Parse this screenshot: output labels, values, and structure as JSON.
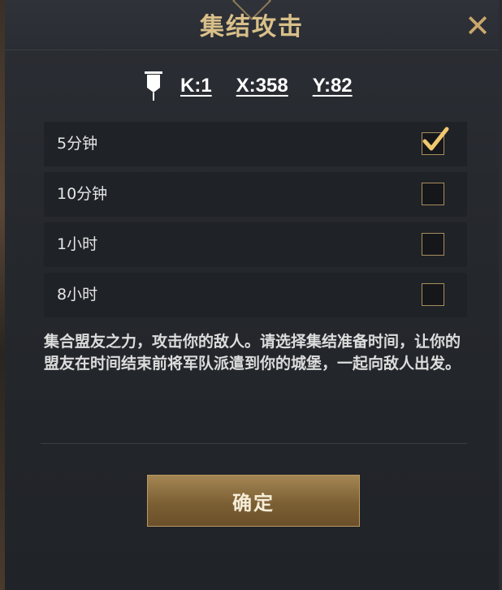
{
  "dialog": {
    "title": "集结攻击",
    "close_icon": "close-icon",
    "coords": {
      "k": "K:1",
      "x": "X:358",
      "y": "Y:82",
      "icon": "banner-flag-icon"
    },
    "options": [
      {
        "label": "5分钟",
        "checked": true
      },
      {
        "label": "10分钟",
        "checked": false
      },
      {
        "label": "1小时",
        "checked": false
      },
      {
        "label": "8小时",
        "checked": false
      }
    ],
    "description": "集合盟友之力，攻击你的敌人。请选择集结准备时间，让你的盟友在时间结束前将军队派遣到你的城堡，一起向敌人出发。",
    "confirm_label": "确定"
  },
  "colors": {
    "gold": "#d9c08a",
    "checkbox_border": "#a88f5c",
    "button_top": "#a48653",
    "button_bottom": "#6a4f2a"
  }
}
